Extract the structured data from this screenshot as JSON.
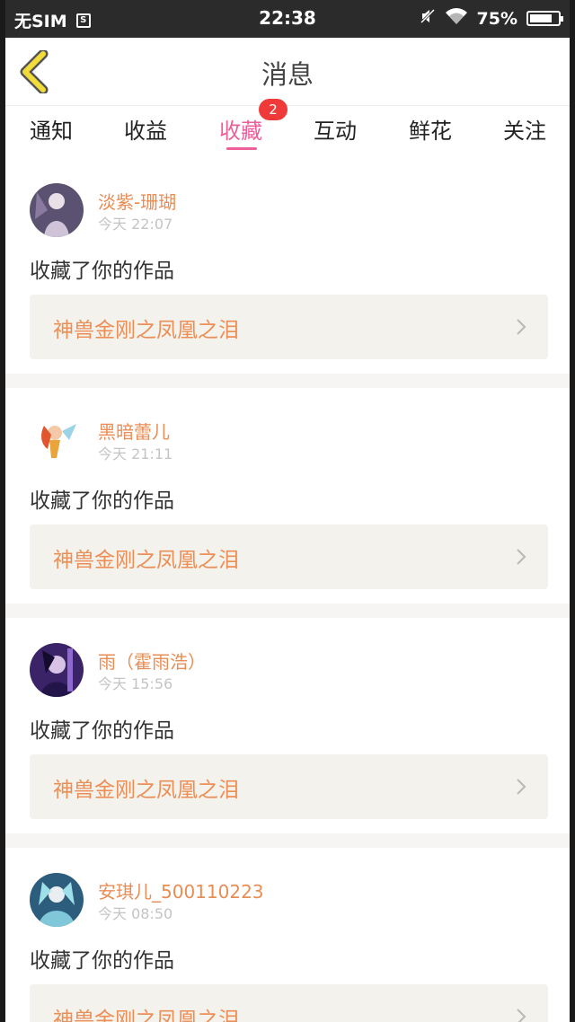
{
  "status_bar": {
    "carrier": "无SIM",
    "sim_icon_letter": "S",
    "time": "22:38",
    "battery": "75%",
    "battery_level": 0.75
  },
  "nav": {
    "title": "消息"
  },
  "tabs": {
    "items": [
      "通知",
      "收益",
      "收藏",
      "互动",
      "鲜花",
      "关注"
    ],
    "active_index": 2,
    "badge": "2"
  },
  "feed": [
    {
      "username": "淡紫-珊瑚",
      "time": "今天 22:07",
      "action": "收藏了你的作品",
      "work_title": "神兽金刚之凤凰之泪"
    },
    {
      "username": "黑暗蕾儿",
      "time": "今天 21:11",
      "action": "收藏了你的作品",
      "work_title": "神兽金刚之凤凰之泪"
    },
    {
      "username": "雨（霍雨浩）",
      "time": "今天 15:56",
      "action": "收藏了你的作品",
      "work_title": "神兽金刚之凤凰之泪"
    },
    {
      "username": "安琪儿_500110223",
      "time": "今天 08:50",
      "action": "收藏了你的作品",
      "work_title": "神兽金刚之凤凰之泪"
    }
  ],
  "colors": {
    "accent_pink": "#ee5f9a",
    "username_orange": "#e98d55",
    "work_title_orange": "#ec8f57",
    "badge_red": "#f03a3a",
    "back_icon_yellow": "#f2dc3a"
  }
}
